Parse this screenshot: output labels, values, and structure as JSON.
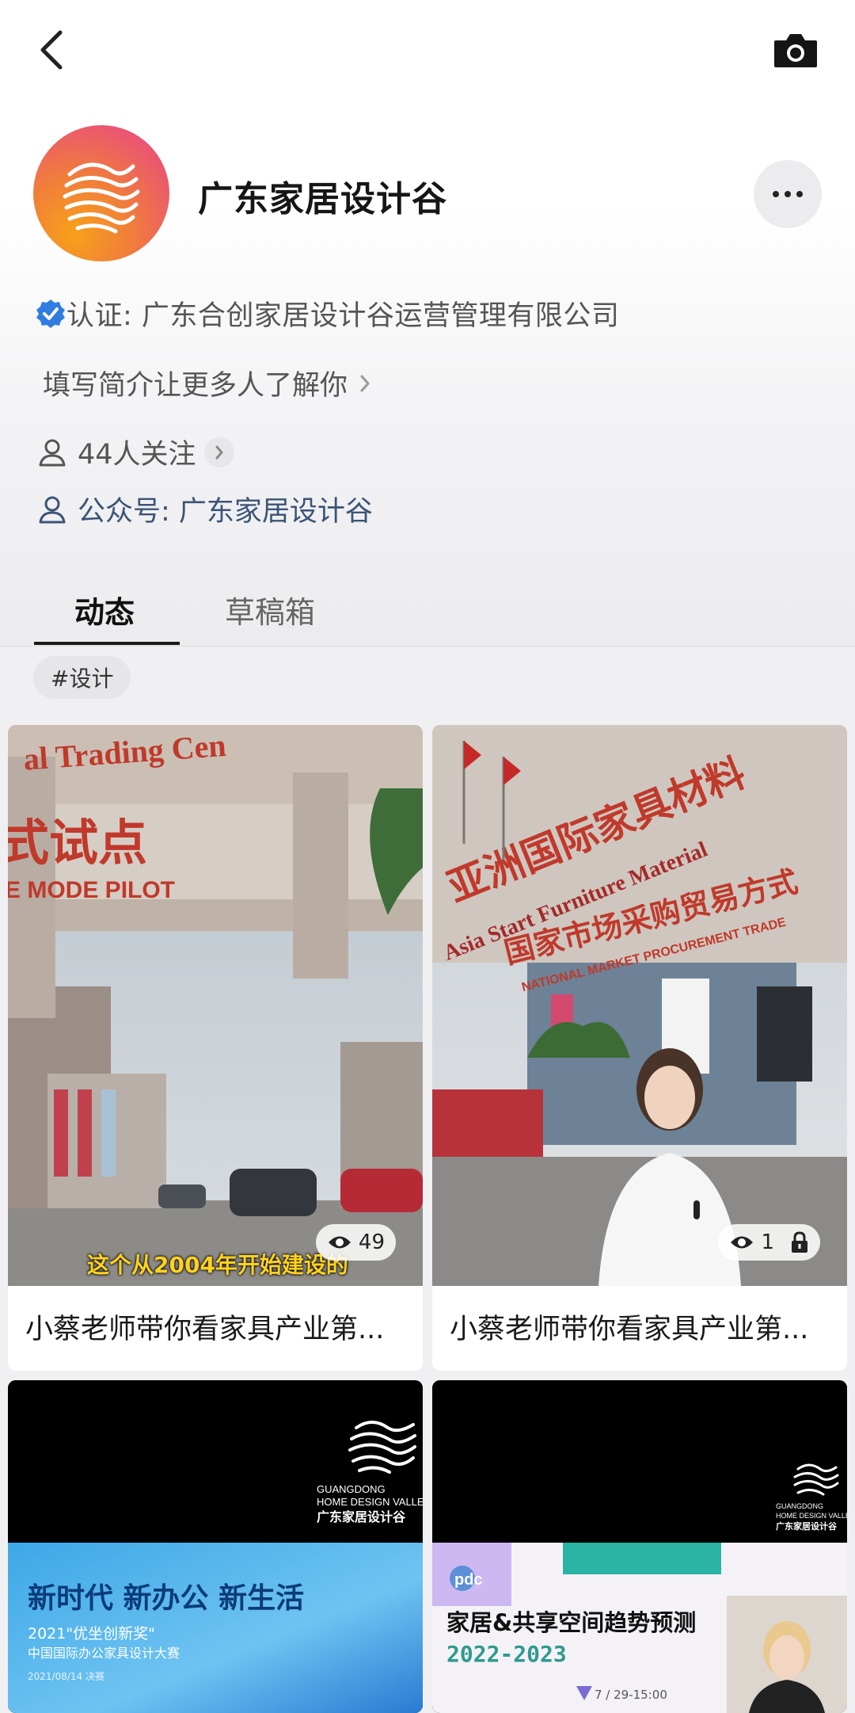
{
  "nav": {
    "back_icon": "chevron-left-icon",
    "camera_icon": "camera-icon"
  },
  "profile": {
    "name": "广东家居设计谷",
    "certification": "认证: 广东合创家居设计谷运营管理有限公司",
    "intro_prompt": "填写简介让更多人了解你",
    "following": "44人关注",
    "official_account": "公众号: 广东家居设计谷",
    "more_icon": "ellipsis-icon"
  },
  "tabs": [
    {
      "label": "动态"
    },
    {
      "label": "草稿箱"
    }
  ],
  "tag": "#设计",
  "posts": [
    {
      "title": "小蔡老师带你看家具产业第...",
      "views": "49",
      "subtitle": "这个从2004年开始建设的",
      "sign_top": "al  Trading  Cen",
      "sign_cn": "式试点",
      "sign_en": "E MODE PILOT"
    },
    {
      "title": "小蔡老师带你看家具产业第...",
      "views": "1",
      "locked": true,
      "sign_top": "亚洲国际家具材料",
      "sign_en": "Asia Start Furniture Material",
      "sign_cn2": "国家市场采购贸易方式",
      "sign_en2": "NATIONAL MARKET PROCUREMENT TRADE"
    },
    {
      "brand_en1": "GUANGDONG",
      "brand_en2": "HOME DESIGN VALLEY",
      "brand_cn": "广东家居设计谷",
      "banner_title": "新时代 新办公 新生活",
      "banner_line1": "2021\"优坐创新奖\"",
      "banner_line2": "中国国际办公家具设计大赛",
      "banner_date": "2021/08/14 决赛"
    },
    {
      "brand_en1": "GUANGDONG",
      "brand_en2": "HOME DESIGN VALLEY",
      "brand_cn": "广东家居设计谷",
      "logo": "pdc",
      "banner_title": "家居&共享空间趋势预测",
      "banner_years": "2022-2023",
      "banner_date": "7 / 29-15:00"
    }
  ],
  "colors": {
    "accent_blue": "#2f7de1",
    "link": "#3b5476",
    "tab_underline": "#1a1a1a"
  }
}
